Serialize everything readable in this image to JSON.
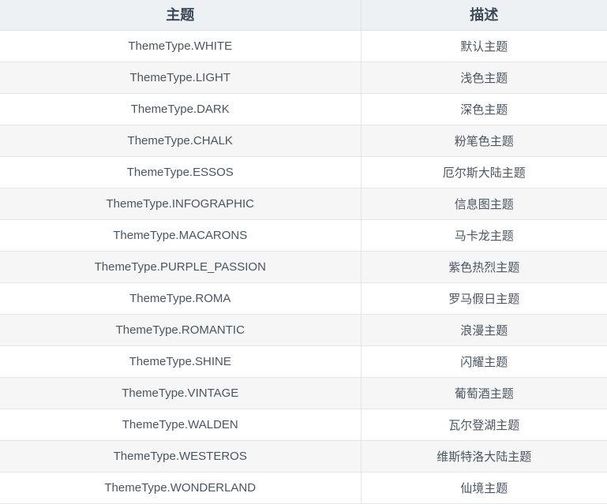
{
  "table": {
    "headers": {
      "theme": "主题",
      "description": "描述"
    },
    "rows": [
      {
        "theme": "ThemeType.WHITE",
        "description": "默认主题"
      },
      {
        "theme": "ThemeType.LIGHT",
        "description": "浅色主题"
      },
      {
        "theme": "ThemeType.DARK",
        "description": "深色主题"
      },
      {
        "theme": "ThemeType.CHALK",
        "description": "粉笔色主题"
      },
      {
        "theme": "ThemeType.ESSOS",
        "description": "厄尔斯大陆主题"
      },
      {
        "theme": "ThemeType.INFOGRAPHIC",
        "description": "信息图主题"
      },
      {
        "theme": "ThemeType.MACARONS",
        "description": "马卡龙主题"
      },
      {
        "theme": "ThemeType.PURPLE_PASSION",
        "description": "紫色热烈主题"
      },
      {
        "theme": "ThemeType.ROMA",
        "description": "罗马假日主题"
      },
      {
        "theme": "ThemeType.ROMANTIC",
        "description": "浪漫主题"
      },
      {
        "theme": "ThemeType.SHINE",
        "description": "闪耀主题"
      },
      {
        "theme": "ThemeType.VINTAGE",
        "description": "葡萄酒主题"
      },
      {
        "theme": "ThemeType.WALDEN",
        "description": "瓦尔登湖主题"
      },
      {
        "theme": "ThemeType.WESTEROS",
        "description": "维斯特洛大陆主题"
      },
      {
        "theme": "ThemeType.WONDERLAND",
        "description": "仙境主题"
      }
    ]
  },
  "colors": {
    "header_background": "#edf1f3",
    "header_text": "#3c4858",
    "row_background_odd": "#ffffff",
    "row_background_even": "#f6f6f6",
    "body_text": "#4a5561",
    "border": "#e3e6e8"
  }
}
